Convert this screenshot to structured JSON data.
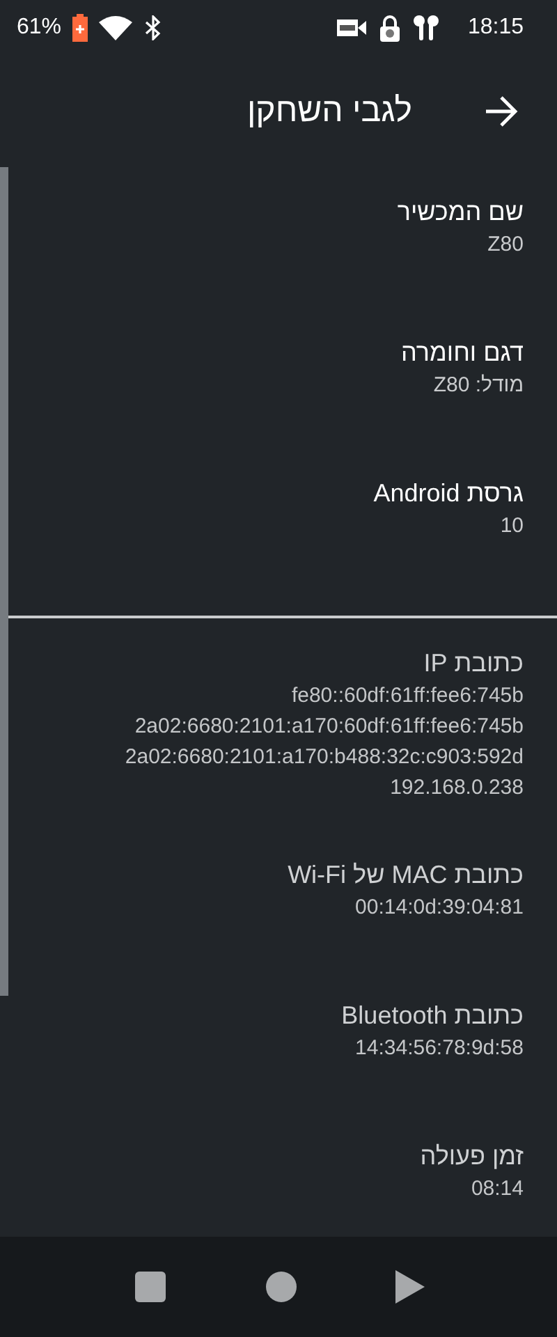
{
  "status_bar": {
    "battery": "61%",
    "time": "18:15"
  },
  "header": {
    "title": "לגבי השחקן"
  },
  "sections": [
    {
      "dimmed": false,
      "items": [
        {
          "title": "שם המכשיר",
          "values": [
            "Z80"
          ]
        },
        {
          "title": "דגם וחומרה",
          "values": [
            "מודל: Z80"
          ]
        },
        {
          "title": "גרסת Android",
          "values": [
            "10"
          ]
        }
      ]
    },
    {
      "dimmed": true,
      "items": [
        {
          "title": "כתובת IP",
          "values": [
            "fe80::60df:61ff:fee6:745b",
            "2a02:6680:2101:a170:60df:61ff:fee6:745b",
            "2a02:6680:2101:a170:b488:32c:c903:592d",
            "192.168.0.238"
          ]
        },
        {
          "title": "כתובת MAC של Wi-Fi",
          "values": [
            "00:14:0d:39:04:81"
          ]
        },
        {
          "title": "כתובת Bluetooth",
          "values": [
            "14:34:56:78:9d:58"
          ]
        },
        {
          "title": "זמן פעולה",
          "values": [
            "08:14"
          ]
        }
      ]
    }
  ]
}
